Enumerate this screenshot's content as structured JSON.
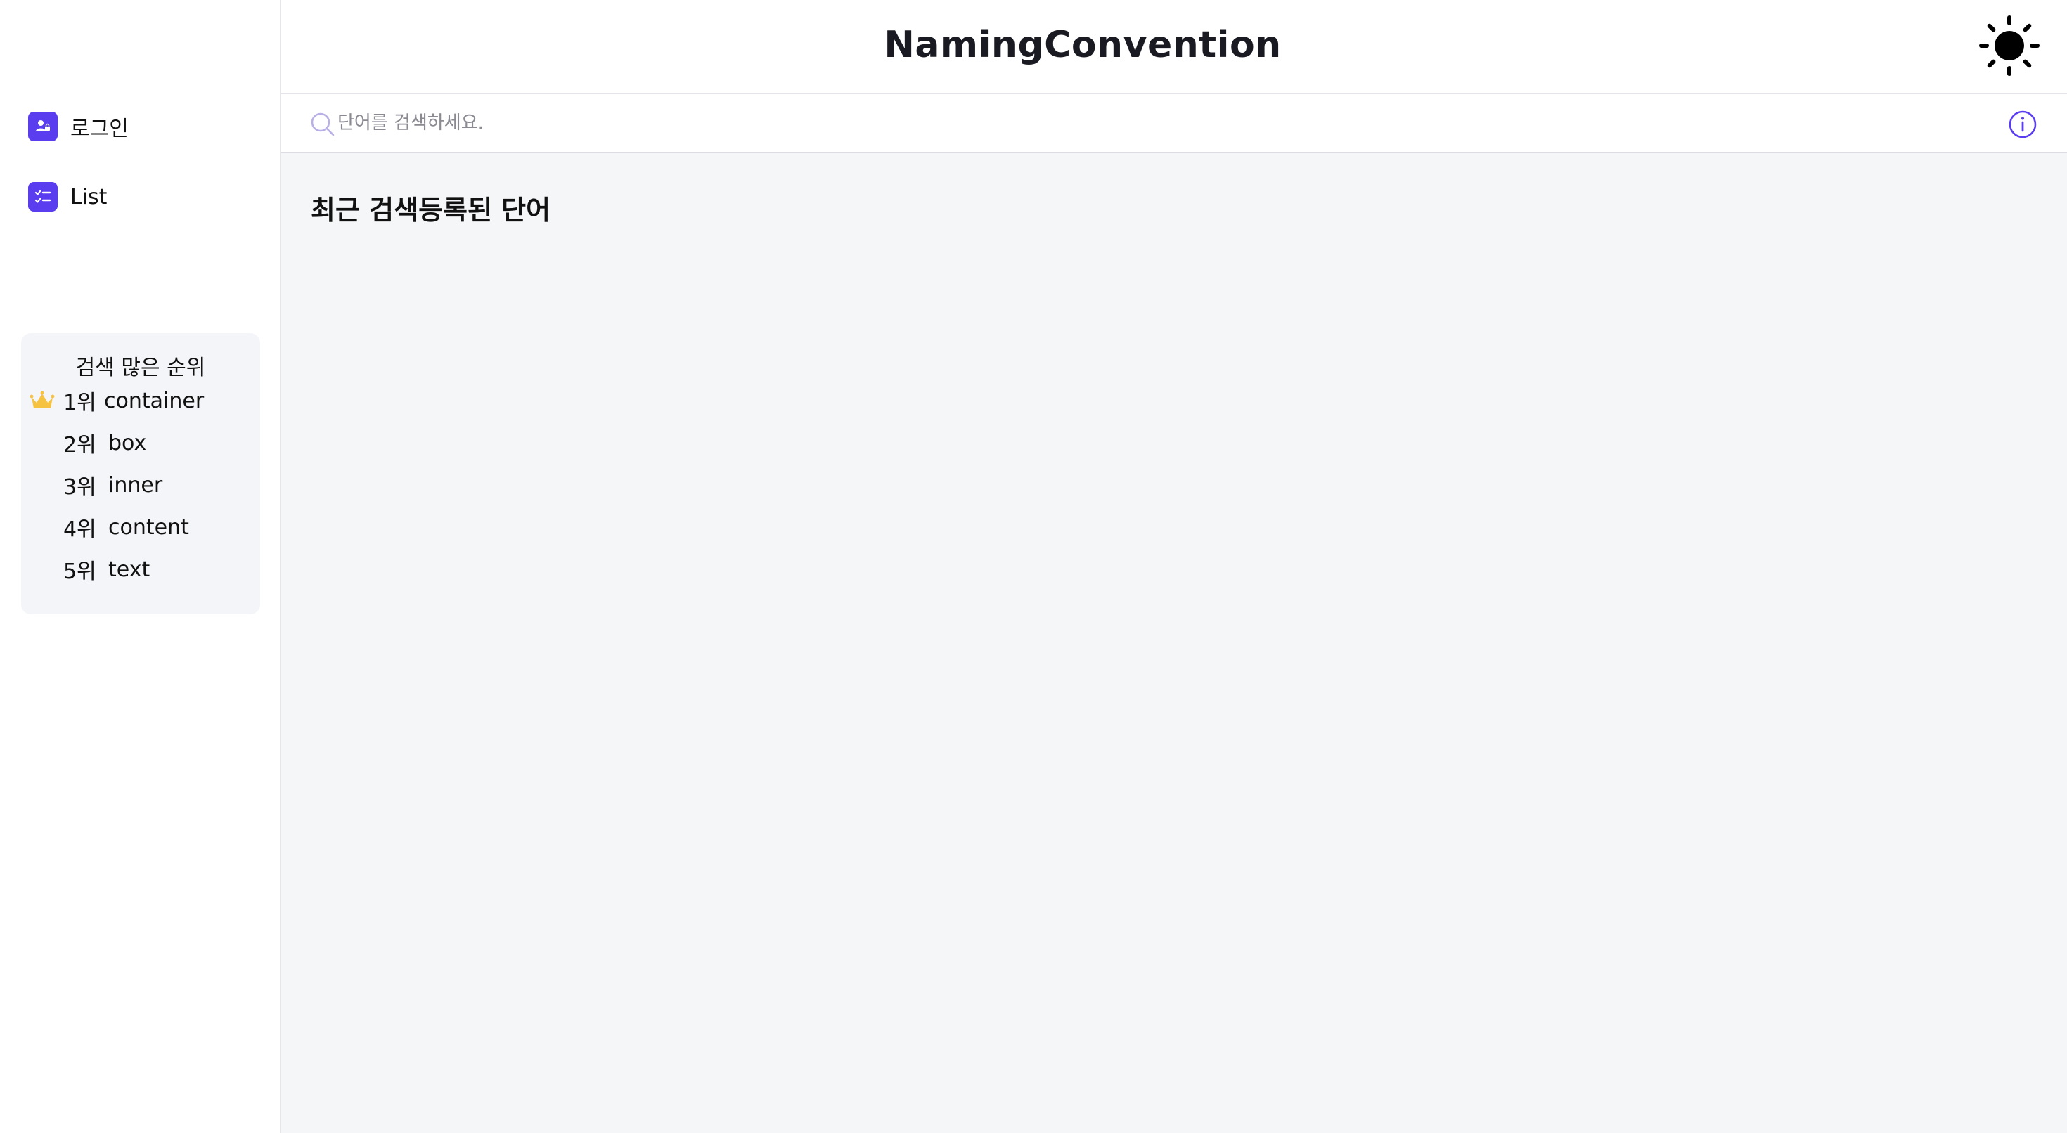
{
  "header": {
    "title": "NamingConvention"
  },
  "sidebar": {
    "items": [
      {
        "label": "로그인",
        "icon": "user-icon"
      },
      {
        "label": "List",
        "icon": "checklist-icon"
      }
    ],
    "ranking": {
      "title": "검색 많은 순위",
      "items": [
        {
          "rank": "1위",
          "word": "container",
          "crown": true
        },
        {
          "rank": "2위",
          "word": "box"
        },
        {
          "rank": "3위",
          "word": "inner"
        },
        {
          "rank": "4위",
          "word": "content"
        },
        {
          "rank": "5위",
          "word": "text"
        }
      ]
    }
  },
  "search": {
    "placeholder": "단어를 검색하세요."
  },
  "main": {
    "section_title": "최근 검색등록된 단어"
  },
  "colors": {
    "accent": "#5b3df0",
    "crown": "#f5c242",
    "main_bg": "#f5f6f8"
  }
}
